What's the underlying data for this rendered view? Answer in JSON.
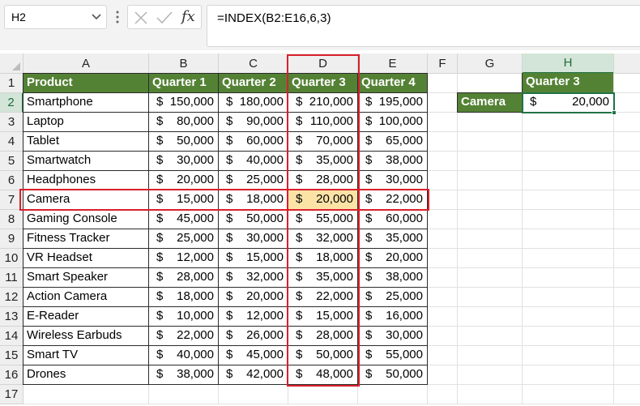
{
  "name_box": "H2",
  "formula": "=INDEX(B2:E16,6,3)",
  "fx_label": "fx",
  "icons": {
    "cancel": "cross-icon",
    "enter": "check-icon",
    "function": "fx-icon",
    "dropdown": "chevron-down-icon",
    "more": "vertical-dots-icon"
  },
  "columns": [
    "A",
    "B",
    "C",
    "D",
    "E",
    "F",
    "G",
    "H"
  ],
  "rows": [
    "1",
    "2",
    "3",
    "4",
    "5",
    "6",
    "7",
    "8",
    "9",
    "10",
    "11",
    "12",
    "13",
    "14",
    "15",
    "16",
    "17"
  ],
  "table": {
    "headers": [
      "Product",
      "Quarter 1",
      "Quarter 2",
      "Quarter 3",
      "Quarter 4"
    ],
    "currency": "$",
    "rows": [
      [
        "Smartphone",
        "150,000",
        "180,000",
        "210,000",
        "195,000"
      ],
      [
        "Laptop",
        "80,000",
        "90,000",
        "110,000",
        "100,000"
      ],
      [
        "Tablet",
        "50,000",
        "60,000",
        "70,000",
        "65,000"
      ],
      [
        "Smartwatch",
        "30,000",
        "40,000",
        "35,000",
        "38,000"
      ],
      [
        "Headphones",
        "20,000",
        "25,000",
        "28,000",
        "30,000"
      ],
      [
        "Camera",
        "15,000",
        "18,000",
        "20,000",
        "22,000"
      ],
      [
        "Gaming Console",
        "45,000",
        "50,000",
        "55,000",
        "60,000"
      ],
      [
        "Fitness Tracker",
        "25,000",
        "30,000",
        "32,000",
        "35,000"
      ],
      [
        "VR Headset",
        "12,000",
        "15,000",
        "18,000",
        "20,000"
      ],
      [
        "Smart Speaker",
        "28,000",
        "32,000",
        "35,000",
        "38,000"
      ],
      [
        "Action Camera",
        "18,000",
        "20,000",
        "22,000",
        "25,000"
      ],
      [
        "E-Reader",
        "10,000",
        "12,000",
        "15,000",
        "16,000"
      ],
      [
        "Wireless Earbuds",
        "22,000",
        "26,000",
        "28,000",
        "30,000"
      ],
      [
        "Smart TV",
        "40,000",
        "45,000",
        "50,000",
        "55,000"
      ],
      [
        "Drones",
        "38,000",
        "42,000",
        "48,000",
        "50,000"
      ]
    ]
  },
  "lookup": {
    "header": "Quarter 3",
    "label": "Camera",
    "currency": "$",
    "value": "20,000"
  },
  "colors": {
    "header_fill": "#548235",
    "highlight_fill": "#fbe3a6",
    "red_outline": "#d9202c",
    "selection": "#217346"
  }
}
